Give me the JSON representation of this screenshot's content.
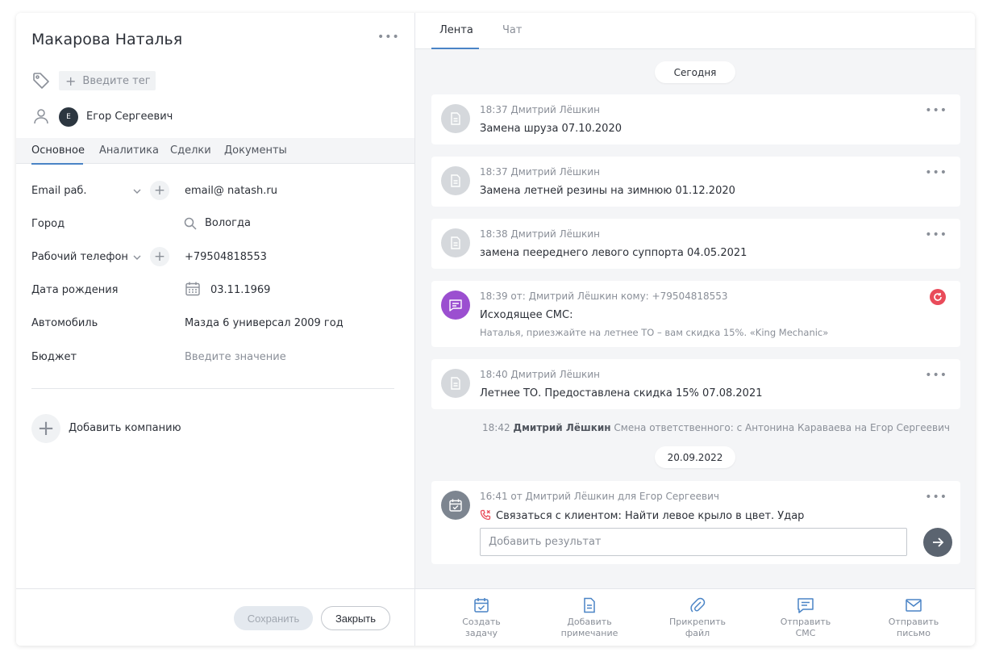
{
  "contact": {
    "name": "Макарова Наталья",
    "tag_placeholder": "Введите тег",
    "owner_initial": "Е",
    "owner_name": "Егор Сергеевич"
  },
  "left_tabs": [
    {
      "label": "Основное"
    },
    {
      "label": "Аналитика"
    },
    {
      "label": "Сделки"
    },
    {
      "label": "Документы"
    }
  ],
  "fields": {
    "email": {
      "label": "Email раб.",
      "value": "email@ natash.ru"
    },
    "city": {
      "label": "Город",
      "value": "Вологда"
    },
    "phone": {
      "label": "Рабочий телефон",
      "value": "+79504818553"
    },
    "birthday": {
      "label": "Дата рождения",
      "value": "03.11.1969"
    },
    "car": {
      "label": "Автомобиль",
      "value": "Мазда 6 универсал 2009 год"
    },
    "budget": {
      "label": "Бюджет",
      "placeholder": "Введите значение"
    }
  },
  "add_company_label": "Добавить компанию",
  "left_footer": {
    "save_label": "Сохранить",
    "close_label": "Закрыть"
  },
  "right_tabs": [
    {
      "label": "Лента"
    },
    {
      "label": "Чат"
    }
  ],
  "feed": {
    "date_today": "Сегодня",
    "entries": [
      {
        "meta": "18:37 Дмитрий Лёшкин",
        "text": "Замена шруза 07.10.2020"
      },
      {
        "meta": "18:37 Дмитрий Лёшкин",
        "text": "Замена летней резины на зимнюю 01.12.2020"
      },
      {
        "meta": "18:38 Дмитрий Лёшкин",
        "text": "замена пеереднего левого суппорта 04.05.2021"
      },
      {
        "meta": "18:39 от: Дмитрий Лёшкин кому: +79504818553",
        "text": "Исходящее СМС:",
        "sub": "Наталья, приезжайте на летнее ТО – вам скидка 15%. «King Mechanic»"
      },
      {
        "meta": "18:40 Дмитрий Лёшкин",
        "text": "Летнее ТО. Предоставлена скидка 15% 07.08.2021"
      }
    ],
    "system": {
      "time": "18:42",
      "author": "Дмитрий Лёшкин",
      "text": "Смена ответственного: с Антонина Караваева на Егор Сергеевич"
    },
    "date_second": "20.09.2022",
    "task": {
      "meta": "16:41 от Дмитрий Лёшкин для Егор Сергеевич",
      "text": "Связаться с клиентом: Найти левое крыло в цвет. Удар",
      "result_placeholder": "Добавить результат"
    }
  },
  "actions": [
    {
      "line1": "Создать",
      "line2": "задачу"
    },
    {
      "line1": "Добавить",
      "line2": "примечание"
    },
    {
      "line1": "Прикрепить",
      "line2": "файл"
    },
    {
      "line1": "Отправить",
      "line2": "СМС"
    },
    {
      "line1": "Отправить",
      "line2": "письмо"
    }
  ],
  "colors": {
    "accent": "#4a84c6",
    "sms_icon": "#9b4fd0",
    "error": "#e94b5a"
  }
}
